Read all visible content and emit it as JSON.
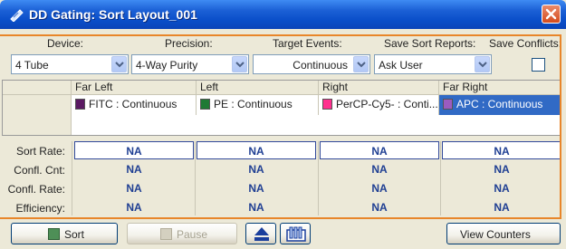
{
  "window": {
    "title": "DD Gating: Sort Layout_001"
  },
  "settings": {
    "device_label": "Device:",
    "precision_label": "Precision:",
    "target_events_label": "Target Events:",
    "save_sort_reports_label": "Save Sort Reports:",
    "save_conflicts_label": "Save Conflicts:",
    "device_value": "4 Tube",
    "precision_value": "4-Way Purity",
    "target_events_value": "Continuous",
    "save_sort_reports_value": "Ask User",
    "save_conflicts_checked": false
  },
  "tubes": {
    "columns": [
      {
        "header": "Far Left",
        "gate": "FITC : Continuous",
        "color": "#5b1a63"
      },
      {
        "header": "Left",
        "gate": "PE : Continuous",
        "color": "#1f7a35"
      },
      {
        "header": "Right",
        "gate": "PerCP-Cy5- : Conti...",
        "color": "#ff2f8e"
      },
      {
        "header": "Far Right",
        "gate": "APC : Continuous",
        "color": "#9b5bc0"
      }
    ],
    "selected_color": "#316ac5"
  },
  "stats": {
    "rows": [
      {
        "label": "Sort Rate:",
        "values": [
          "NA",
          "NA",
          "NA",
          "NA"
        ]
      },
      {
        "label": "Confl. Cnt:",
        "values": [
          "NA",
          "NA",
          "NA",
          "NA"
        ]
      },
      {
        "label": "Confl. Rate:",
        "values": [
          "NA",
          "NA",
          "NA",
          "NA"
        ]
      },
      {
        "label": "Efficiency:",
        "values": [
          "NA",
          "NA",
          "NA",
          "NA"
        ]
      }
    ]
  },
  "buttons": {
    "sort": "Sort",
    "pause": "Pause",
    "view_counters": "View Counters"
  },
  "icons": {
    "title": "window-app-icon",
    "close": "close-icon",
    "eject": "eject-icon",
    "tubes": "tube-rack-icon"
  }
}
